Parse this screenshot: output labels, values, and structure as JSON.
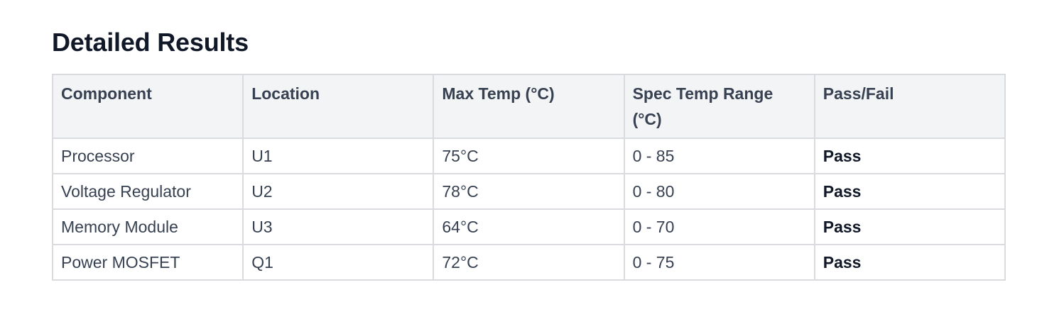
{
  "section": {
    "title": "Detailed Results"
  },
  "table": {
    "headers": [
      "Component",
      "Location",
      "Max Temp (°C)",
      "Spec Temp Range (°C)",
      "Pass/Fail"
    ],
    "rows": [
      [
        "Processor",
        "U1",
        "75°C",
        "0 - 85",
        "Pass"
      ],
      [
        "Voltage Regulator",
        "U2",
        "78°C",
        "0 - 80",
        "Pass"
      ],
      [
        "Memory Module",
        "U3",
        "64°C",
        "0 - 70",
        "Pass"
      ],
      [
        "Power MOSFET",
        "Q1",
        "72°C",
        "0 - 75",
        "Pass"
      ]
    ]
  }
}
